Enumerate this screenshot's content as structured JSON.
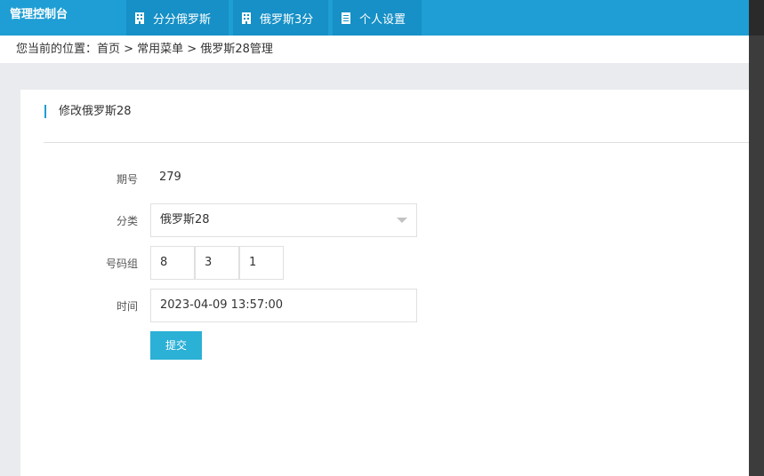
{
  "header": {
    "brand": "管理控制台",
    "tabs": [
      {
        "label": "分分俄罗斯",
        "icon": "building-icon"
      },
      {
        "label": "俄罗斯3分",
        "icon": "building-icon"
      },
      {
        "label": "个人设置",
        "icon": "document-icon"
      }
    ]
  },
  "breadcrumb": {
    "text": "您当前的位置：首页 > 常用菜单 > 俄罗斯28管理"
  },
  "card": {
    "title": "修改俄罗斯28"
  },
  "form": {
    "period_label": "期号",
    "period_value": "279",
    "category_label": "分类",
    "category_value": "俄罗斯28",
    "numbers_label": "号码组",
    "numbers": [
      "8",
      "3",
      "1"
    ],
    "time_label": "时间",
    "time_value": "2023-04-09 13:57:00",
    "submit_label": "提交"
  },
  "colors": {
    "header_bg": "#1e9ed4",
    "tab_bg": "#1690c6",
    "button_bg": "#2bb0d6",
    "page_bg": "#e9ebef"
  }
}
